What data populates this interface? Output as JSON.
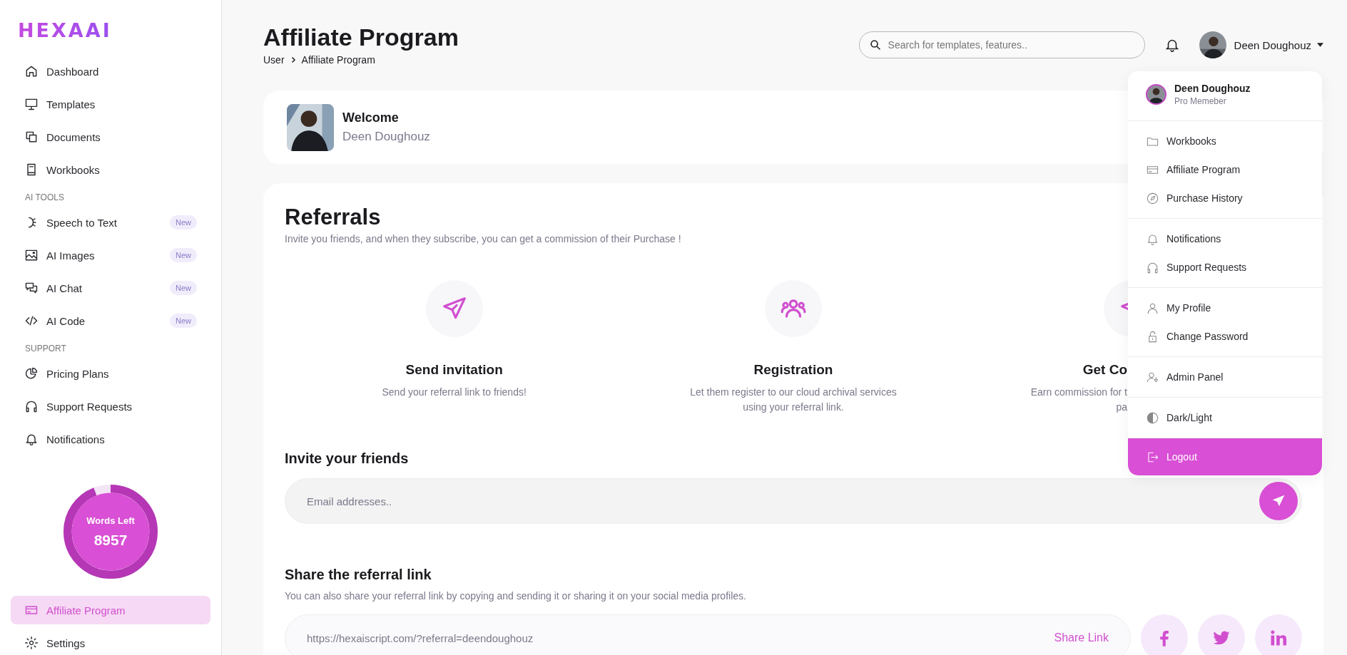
{
  "sidebar": {
    "logo": "HEXAAI",
    "sections": [
      {
        "items": [
          {
            "label": "Dashboard",
            "selected": false
          },
          {
            "label": "Templates",
            "selected": false
          },
          {
            "label": "Documents",
            "selected": false
          },
          {
            "label": "Workbooks",
            "selected": false
          }
        ]
      },
      {
        "label": "AI TOOLS",
        "items": [
          {
            "label": "Speech to Text",
            "badge": "New",
            "selected": false
          },
          {
            "label": "AI Images",
            "badge": "New",
            "selected": false
          },
          {
            "label": "AI Chat",
            "badge": "New",
            "selected": false
          },
          {
            "label": "AI Code",
            "badge": "New",
            "selected": false
          }
        ]
      },
      {
        "label": "SUPPORT",
        "items": [
          {
            "label": "Pricing Plans",
            "selected": false
          },
          {
            "label": "Support Requests",
            "selected": false
          },
          {
            "label": "Notifications",
            "selected": false
          }
        ]
      }
    ],
    "words": {
      "label": "Words Left",
      "value": "8957",
      "level": 0.94
    },
    "bottom_items": [
      {
        "label": "Affiliate Program",
        "selected": true
      },
      {
        "label": "Settings",
        "selected": false
      }
    ]
  },
  "header": {
    "title": "Affiliate Program",
    "breadcrumb": [
      "User",
      "Affiliate Program"
    ],
    "search": {
      "placeholder": "Search for templates, features.."
    },
    "user": {
      "name": "Deen Doughouz"
    }
  },
  "welcome": {
    "title": "Welcome",
    "name": "Deen Doughouz"
  },
  "referrals": {
    "title": "Referrals",
    "subtitle": "Invite you friends, and when they subscribe, you can get a commission of their Purchase !",
    "steps": [
      {
        "title": "Send invitation",
        "lines": [
          "Send your referral link to friends!"
        ]
      },
      {
        "title": "Registration",
        "lines": [
          "Let them register to our cloud archival services",
          "using your referral link."
        ]
      },
      {
        "title": "Get Co",
        "lines": [
          "Earn commission for t",
          "pa"
        ]
      }
    ],
    "invite": {
      "title": "Invite your friends",
      "placeholder": "Email addresses.."
    },
    "share": {
      "title": "Share the referral link",
      "subtitle": "You can also share your referral link by copying and sending it or sharing it on your social media profiles.",
      "link": "https://hexaiscript.com/?referral=deendoughouz",
      "action": "Share Link"
    }
  },
  "dropdown": {
    "name": "Deen Doughouz",
    "role": "Pro Memeber",
    "groups": [
      [
        "Workbooks",
        "Affiliate Program",
        "Purchase History"
      ],
      [
        "Notifications",
        "Support Requests"
      ],
      [
        "My Profile",
        "Change Password"
      ],
      [
        "Admin Panel"
      ],
      [
        "Dark/Light"
      ]
    ],
    "logout": "Logout"
  }
}
